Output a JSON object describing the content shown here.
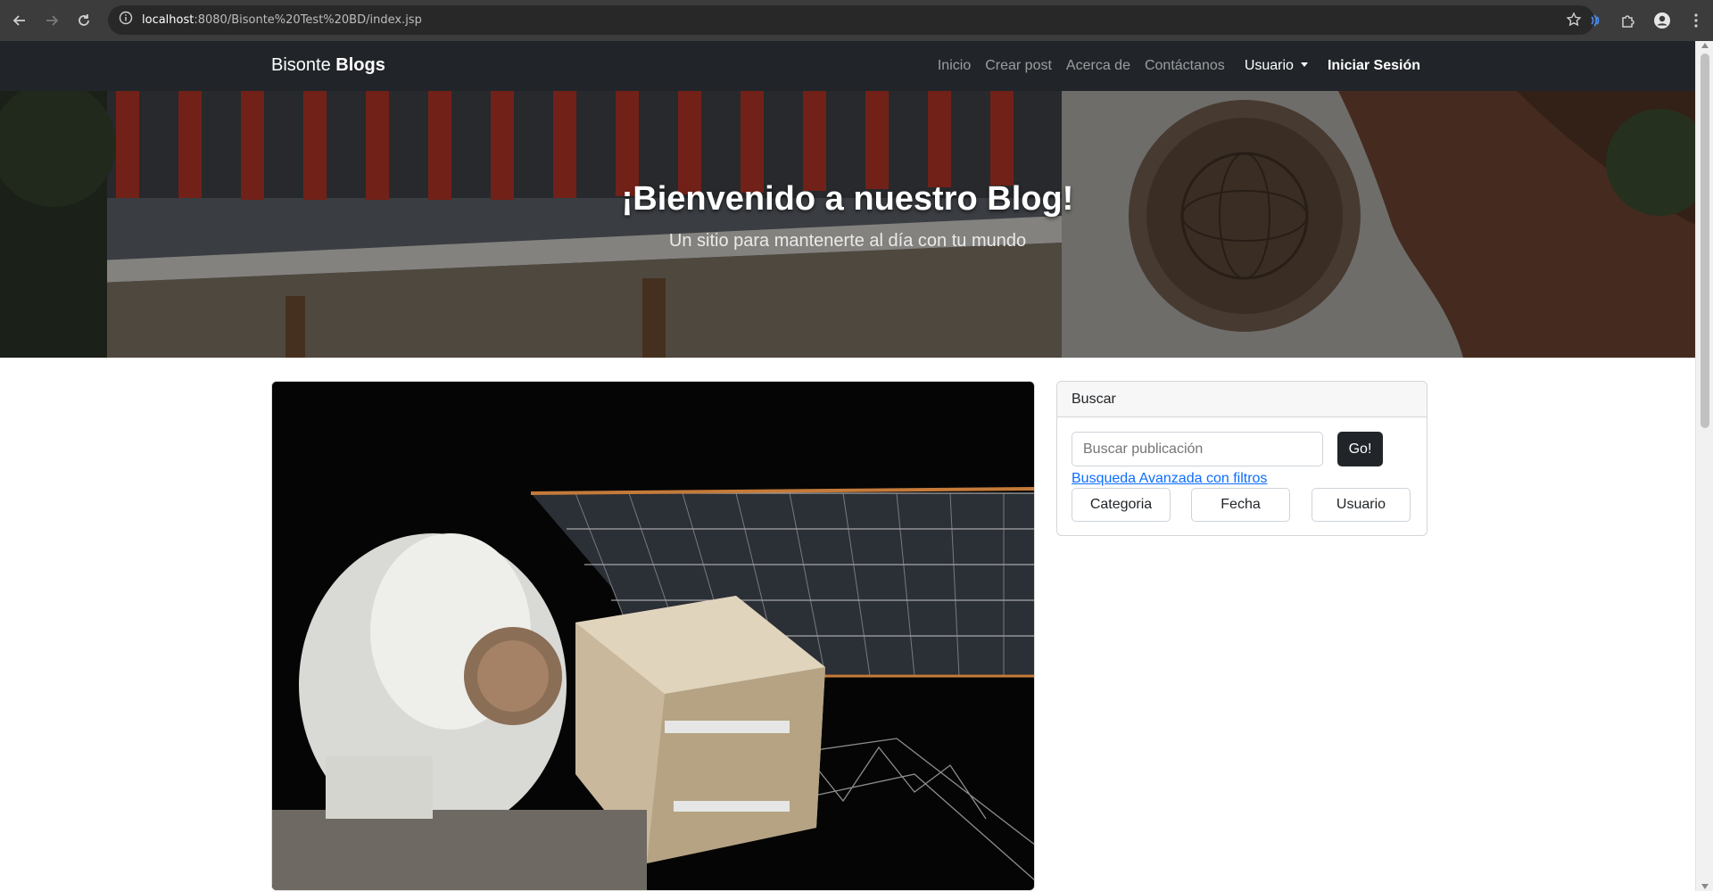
{
  "browser": {
    "url_host": "localhost",
    "url_rest": ":8080/Bisonte%20Test%20BD/index.jsp",
    "icons": [
      "back-arrow-icon",
      "forward-arrow-icon",
      "reload-icon",
      "site-info-icon",
      "star-icon",
      "extension-icon",
      "puzzle-icon",
      "profile-icon",
      "kebab-menu-icon"
    ]
  },
  "navbar": {
    "brand_light": "Bisonte",
    "brand_bold": "Blogs",
    "links": [
      {
        "label": "Inicio"
      },
      {
        "label": "Crear post"
      },
      {
        "label": "Acerca de"
      },
      {
        "label": "Contáctanos"
      }
    ],
    "user_dropdown": "Usuario",
    "login": "Iniciar Sesión",
    "background": "#212529"
  },
  "hero": {
    "title": "¡Bienvenido a nuestro Blog!",
    "subtitle": "Un sitio para mantenerte al día con tu mundo"
  },
  "post": {
    "image_subject": "astronaut-spacewalk-image"
  },
  "search": {
    "header": "Buscar",
    "placeholder": "Buscar publicación",
    "go_label": "Go!",
    "advanced_link": "Busqueda Avanzada con filtros",
    "filters": [
      "Categoria",
      "Fecha",
      "Usuario"
    ]
  },
  "colors": {
    "link": "#0d6efd",
    "dark": "#212529"
  }
}
